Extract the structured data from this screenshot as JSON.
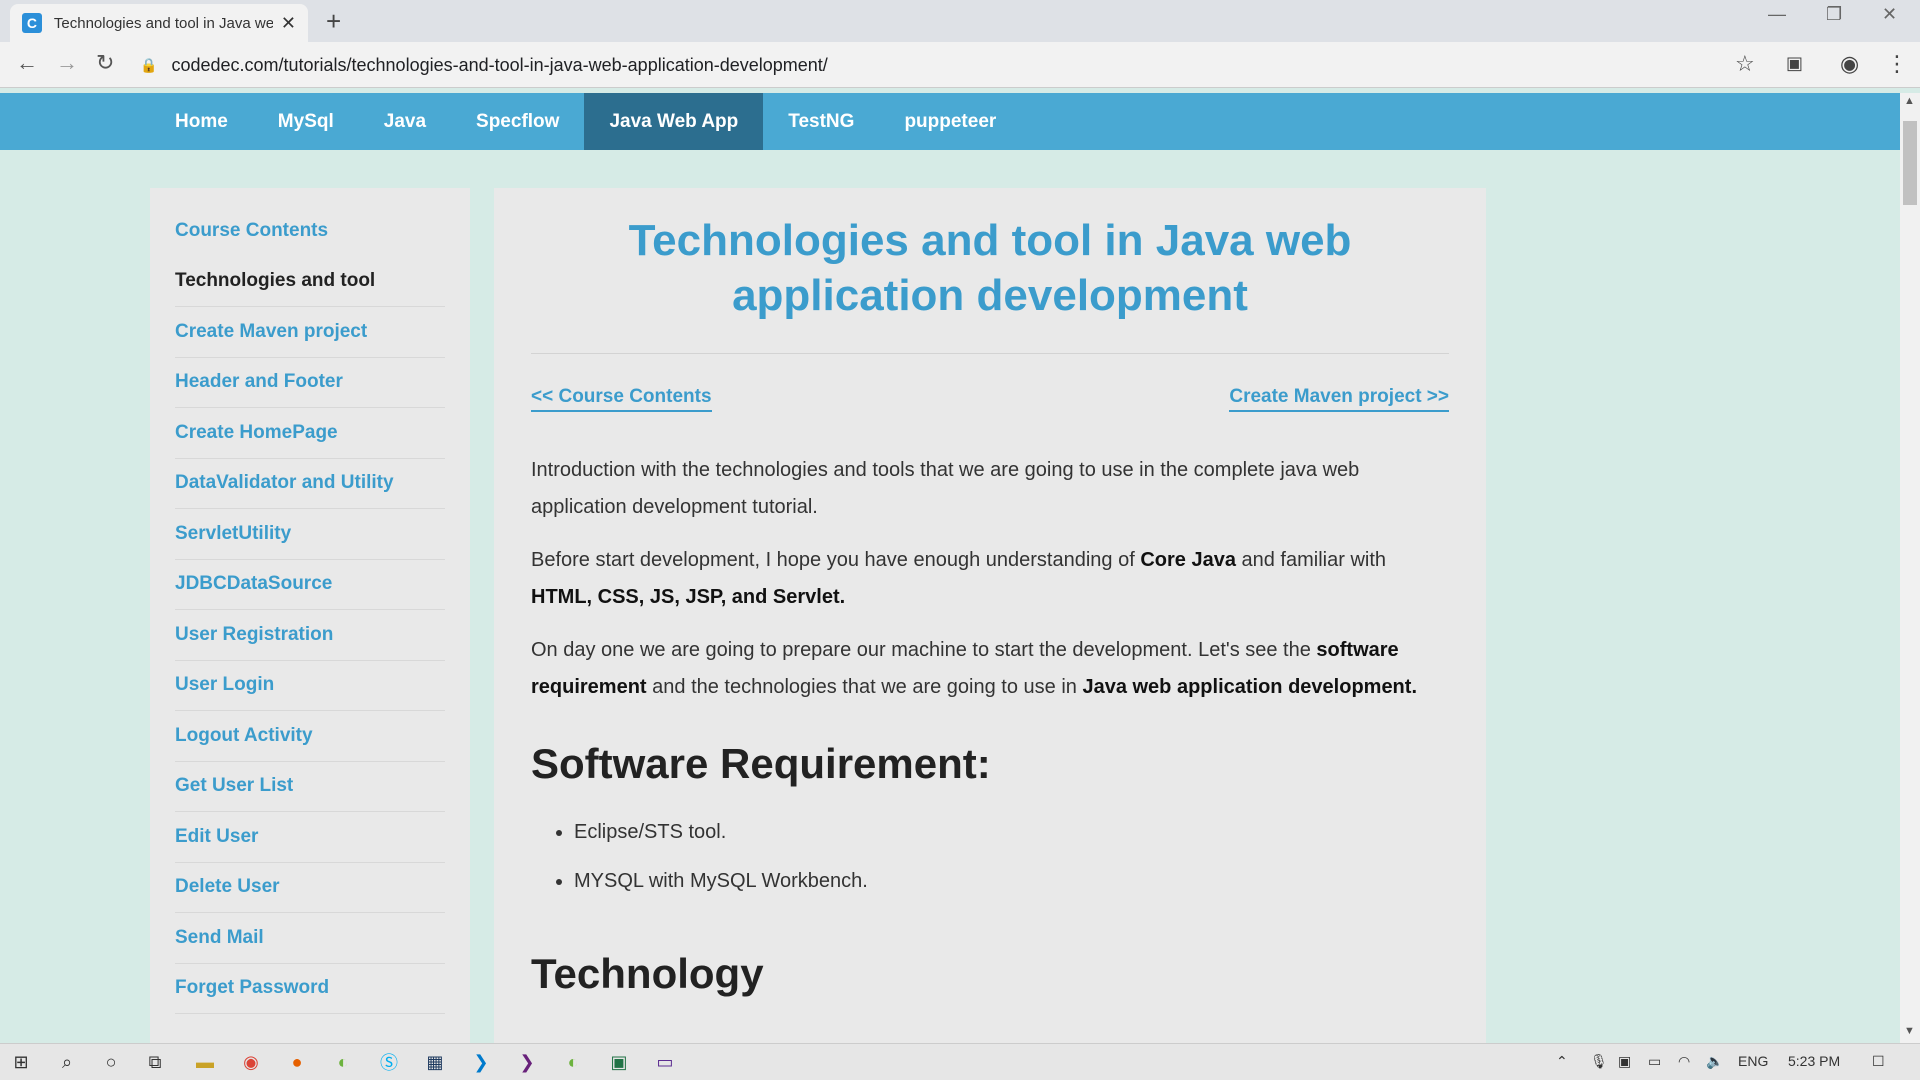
{
  "browser": {
    "tab_title": "Technologies and tool in Java we",
    "favicon_letter": "C",
    "url": "codedec.com/tutorials/technologies-and-tool-in-java-web-application-development/"
  },
  "site_nav": {
    "items": [
      "Home",
      "MySql",
      "Java",
      "Specflow",
      "Java Web App",
      "TestNG",
      "puppeteer"
    ],
    "active": "Java Web App"
  },
  "sidebar": {
    "items": [
      "Course Contents",
      "Technologies and tool",
      "Create Maven project",
      "Header and Footer",
      "Create HomePage",
      "DataValidator and Utility",
      "ServletUtility",
      "JDBCDataSource",
      "User Registration",
      "User Login",
      "Logout Activity",
      "Get User List",
      "Edit User",
      "Delete User",
      "Send Mail",
      "Forget Password"
    ],
    "current": "Technologies and tool"
  },
  "article": {
    "title": "Technologies and tool in Java web application development",
    "prev_link": "<< Course Contents",
    "next_link": "Create Maven project >>",
    "p1": "Introduction with the technologies and tools that we are going to use in the complete java web application development tutorial.",
    "p2_a": "Before start development, I hope you have enough understanding of ",
    "p2_b": "Core Java",
    "p2_c": " and familiar with ",
    "p2_d": "HTML, CSS, JS, JSP, and Servlet.",
    "p3_a": "On day one we are going to prepare our machine to start the development. Let's see the ",
    "p3_b": "software requirement",
    "p3_c": " and the technologies that we are going to use in ",
    "p3_d": "Java web application development.",
    "h_software": "Software Requirement:",
    "requirements": [
      "Eclipse/STS tool.",
      "MYSQL with MySQL Workbench."
    ],
    "h_technology": "Technology"
  },
  "taskbar": {
    "lang": "ENG",
    "time": "5:23 PM"
  }
}
